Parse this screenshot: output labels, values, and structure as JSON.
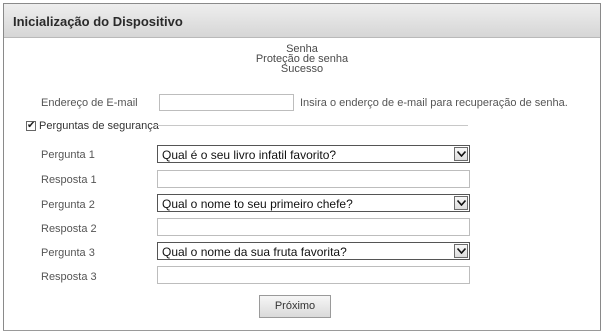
{
  "window": {
    "title": "Inicialização do Dispositivo"
  },
  "steps": [
    "Senha",
    "Proteção de senha",
    "Sucesso"
  ],
  "email": {
    "label": "Endereço de E-mail",
    "value": "",
    "hint": "Insira o enderço de  e-mail para recuperação de senha."
  },
  "security": {
    "label": "Perguntas de segurança",
    "checked": true,
    "check_glyph": "✔",
    "questions": [
      {
        "label": "Pergunta 1",
        "value": "Qual é o seu livro infatil favorito?",
        "answer_label": "Resposta 1",
        "answer_value": ""
      },
      {
        "label": "Pergunta 2",
        "value": "Qual o nome to seu primeiro chefe?",
        "answer_label": "Resposta 2",
        "answer_value": ""
      },
      {
        "label": "Pergunta 3",
        "value": "Qual o nome da sua fruta favorita?",
        "answer_label": "Resposta 3",
        "answer_value": ""
      }
    ]
  },
  "next_button": {
    "label": "Próximo"
  }
}
